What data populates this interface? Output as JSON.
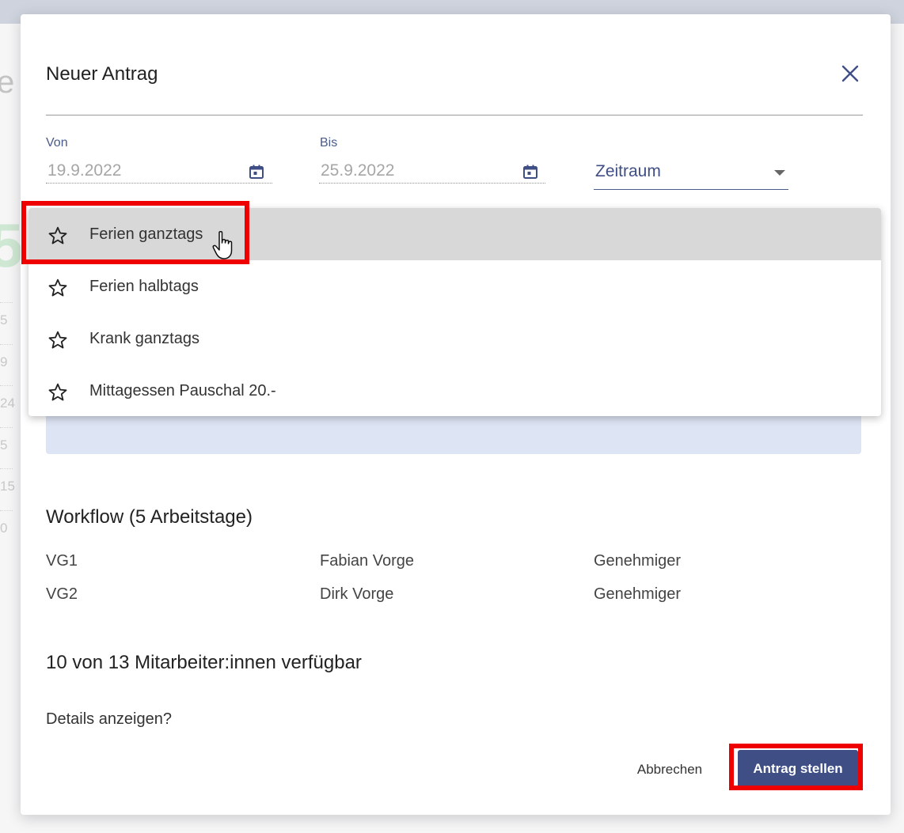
{
  "background": {
    "letter": "e",
    "green_digit": "5",
    "side_numbers": [
      "5",
      "9",
      "24",
      "5",
      "15",
      "0"
    ]
  },
  "dialog": {
    "title": "Neuer Antrag",
    "close_icon": "close-icon"
  },
  "form": {
    "von": {
      "label": "Von",
      "value": "19.9.2022"
    },
    "bis": {
      "label": "Bis",
      "value": "25.9.2022"
    },
    "zeitraum": {
      "value": "Zeitraum"
    }
  },
  "menu": {
    "items": [
      {
        "label": "Ferien ganztags",
        "icon": "star-outline-icon",
        "active": true
      },
      {
        "label": "Ferien halbtags",
        "icon": "star-outline-icon",
        "active": false
      },
      {
        "label": "Krank ganztags",
        "icon": "star-outline-icon",
        "active": false
      },
      {
        "label": "Mittagessen Pauschal 20.-",
        "icon": "star-outline-icon",
        "active": false
      }
    ]
  },
  "workflow": {
    "title": "Workflow (5 Arbeitstage)",
    "rows": [
      {
        "level": "VG1",
        "name": "Fabian Vorge",
        "role": "Genehmiger"
      },
      {
        "level": "VG2",
        "name": "Dirk Vorge",
        "role": "Genehmiger"
      }
    ]
  },
  "availability": {
    "title": "10 von 13 Mitarbeiter:innen verfügbar",
    "details_link": "Details anzeigen?"
  },
  "actions": {
    "cancel_label": "Abbrechen",
    "submit_label": "Antrag stellen"
  },
  "colors": {
    "accent": "#3f4f86",
    "highlight": "#ee0000",
    "info_box": "#dde4f3",
    "menu_active": "#d8d8d8"
  }
}
